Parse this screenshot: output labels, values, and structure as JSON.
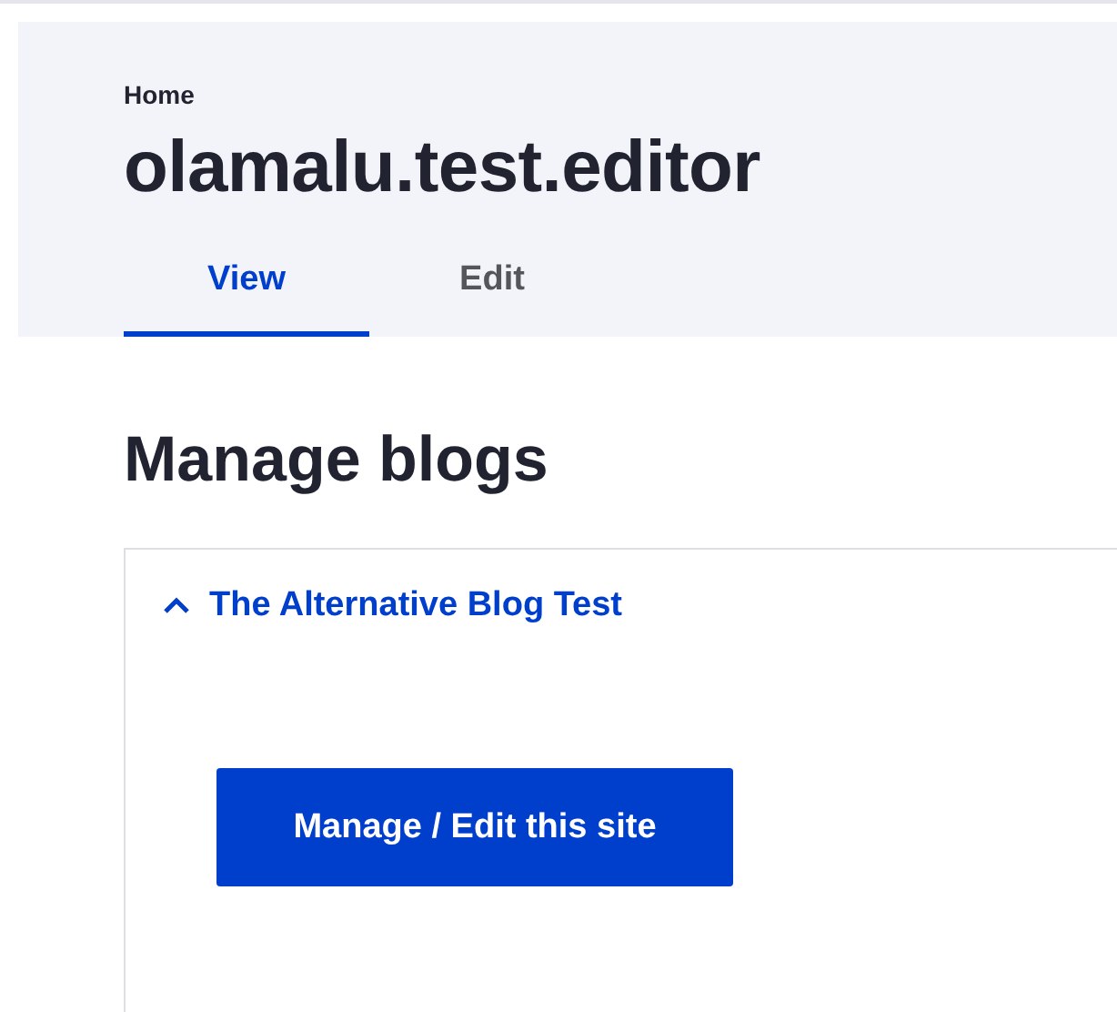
{
  "breadcrumb": "Home",
  "page_title": "olamalu.test.editor",
  "tabs": [
    {
      "label": "View",
      "selected": true
    },
    {
      "label": "Edit",
      "selected": false
    }
  ],
  "section_title": "Manage blogs",
  "accordion": {
    "title": "The Alternative Blog Test",
    "expanded": true,
    "button": "Manage / Edit this site"
  }
}
